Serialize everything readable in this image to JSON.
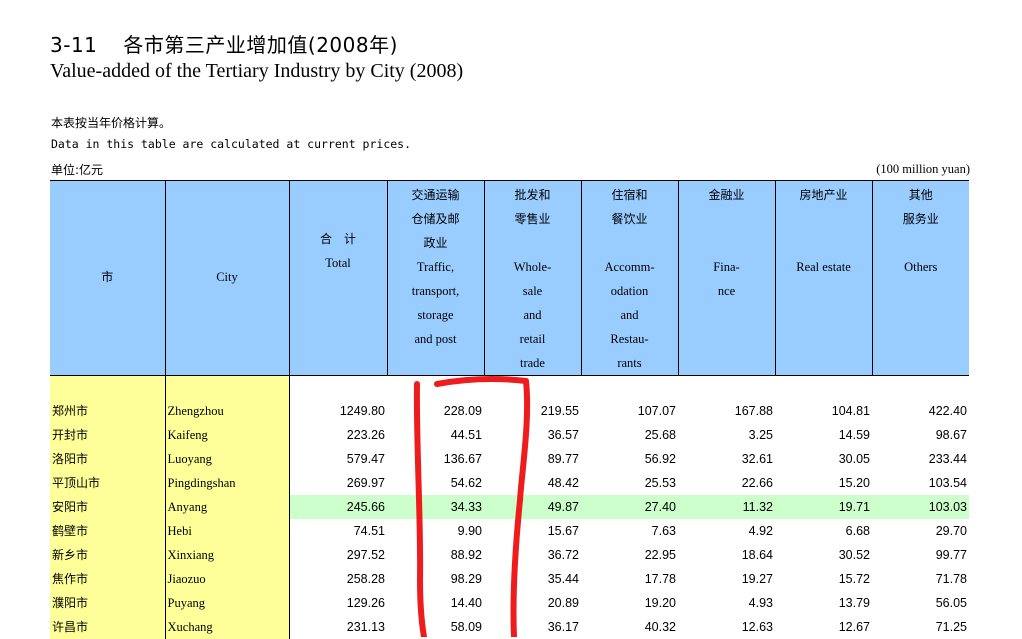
{
  "title": {
    "number": "3-11",
    "cn": "各市第三产业增加值(2008年)",
    "en": "Value-added of the Tertiary Industry by City (2008)"
  },
  "notes": {
    "cn": "本表按当年价格计算。",
    "en": "Data in this table are calculated at current prices."
  },
  "unit": {
    "cn": "单位:亿元",
    "en": "(100 million yuan)"
  },
  "table": {
    "headers": {
      "city_cn": "市",
      "city_en": "City",
      "total_cn": "合　计",
      "total_en": "Total",
      "traffic_cn": "交通运输\n仓储及邮\n政业",
      "traffic_en": "Traffic,\ntransport,\nstorage\nand post",
      "trade_cn": "批发和\n零售业",
      "trade_en": "Whole-\nsale\nand\nretail\ntrade",
      "accom_cn": "住宿和\n餐饮业",
      "accom_en": "Accomm-\nodation\nand\nRestau-\nrants",
      "finance_cn": "金融业",
      "finance_en": "Fina-\nnce",
      "realestate_cn": "房地产业",
      "realestate_en": "Real estate",
      "others_cn": "其他\n服务业",
      "others_en": "Others"
    },
    "rows": [
      {
        "cn": "郑州市",
        "en": "Zhengzhou",
        "total": "1249.80",
        "traffic": "228.09",
        "trade": "219.55",
        "accom": "107.07",
        "finance": "167.88",
        "realestate": "104.81",
        "others": "422.40"
      },
      {
        "cn": "开封市",
        "en": "Kaifeng",
        "total": "223.26",
        "traffic": "44.51",
        "trade": "36.57",
        "accom": "25.68",
        "finance": "3.25",
        "realestate": "14.59",
        "others": "98.67"
      },
      {
        "cn": "洛阳市",
        "en": "Luoyang",
        "total": "579.47",
        "traffic": "136.67",
        "trade": "89.77",
        "accom": "56.92",
        "finance": "32.61",
        "realestate": "30.05",
        "others": "233.44"
      },
      {
        "cn": "平顶山市",
        "en": "Pingdingshan",
        "total": "269.97",
        "traffic": "54.62",
        "trade": "48.42",
        "accom": "25.53",
        "finance": "22.66",
        "realestate": "15.20",
        "others": "103.54"
      },
      {
        "cn": "安阳市",
        "en": "Anyang",
        "total": "245.66",
        "traffic": "34.33",
        "trade": "49.87",
        "accom": "27.40",
        "finance": "11.32",
        "realestate": "19.71",
        "others": "103.03"
      },
      {
        "cn": "鹤壁市",
        "en": "Hebi",
        "total": "74.51",
        "traffic": "9.90",
        "trade": "15.67",
        "accom": "7.63",
        "finance": "4.92",
        "realestate": "6.68",
        "others": "29.70"
      },
      {
        "cn": "新乡市",
        "en": "Xinxiang",
        "total": "297.52",
        "traffic": "88.92",
        "trade": "36.72",
        "accom": "22.95",
        "finance": "18.64",
        "realestate": "30.52",
        "others": "99.77"
      },
      {
        "cn": "焦作市",
        "en": "Jiaozuo",
        "total": "258.28",
        "traffic": "98.29",
        "trade": "35.44",
        "accom": "17.78",
        "finance": "19.27",
        "realestate": "15.72",
        "others": "71.78"
      },
      {
        "cn": "濮阳市",
        "en": "Puyang",
        "total": "129.26",
        "traffic": "14.40",
        "trade": "20.89",
        "accom": "19.20",
        "finance": "4.93",
        "realestate": "13.79",
        "others": "56.05"
      },
      {
        "cn": "许昌市",
        "en": "Xuchang",
        "total": "231.13",
        "traffic": "58.09",
        "trade": "36.17",
        "accom": "40.32",
        "finance": "12.63",
        "realestate": "12.67",
        "others": "71.25"
      }
    ],
    "highlighted_row": "安阳市"
  },
  "colors": {
    "header_bg": "#99ccff",
    "city_bg": "#ffff99",
    "highlight_bg": "#ccffcc",
    "annotation": "#ee1c1c"
  }
}
